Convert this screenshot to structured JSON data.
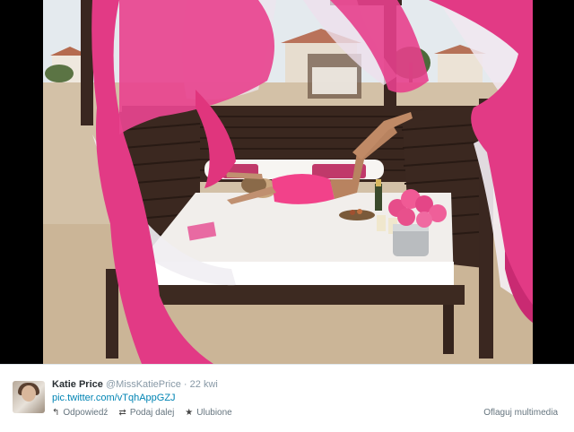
{
  "tweet": {
    "name": "Katie Price",
    "handle": "@MissKatiePrice",
    "separator": "·",
    "time": "22 kwi",
    "link": "pic.twitter.com/vTqhAppGZJ",
    "actions": {
      "reply": {
        "label": "Odpowiedź",
        "icon": "reply-icon"
      },
      "retweet": {
        "label": "Podaj dalej",
        "icon": "retweet-icon"
      },
      "favorite": {
        "label": "Ulubione",
        "icon": "star-icon"
      }
    },
    "flag_media": "Oflaguj multimedia"
  },
  "colors": {
    "background": "#000000",
    "tweet_bg": "#ffffff",
    "link": "#0084b4",
    "muted": "#8899a6",
    "curtain_pink": "#e8357f",
    "wood": "#3e2a21",
    "sand": "#d2c0a6"
  }
}
